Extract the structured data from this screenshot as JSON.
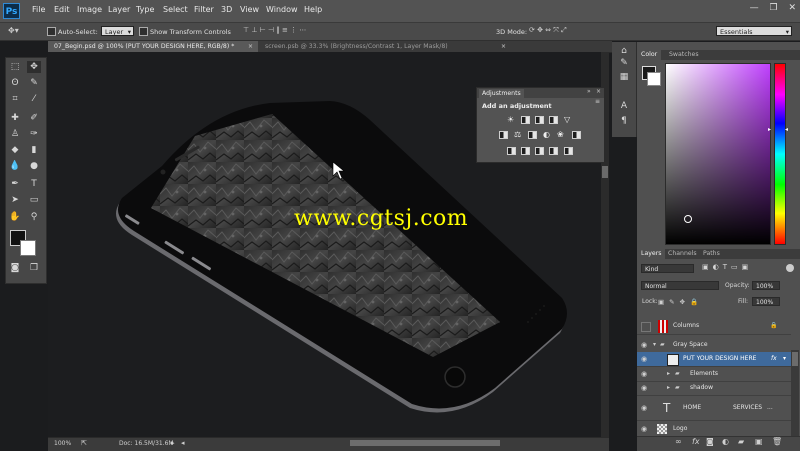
{
  "app": {
    "logo": "Ps"
  },
  "menu": [
    "File",
    "Edit",
    "Image",
    "Layer",
    "Type",
    "Select",
    "Filter",
    "3D",
    "View",
    "Window",
    "Help"
  ],
  "window_controls": [
    "—",
    "❐",
    "✕"
  ],
  "options_bar": {
    "auto_select_label": "Auto-Select:",
    "auto_select_value": "Layer",
    "show_transform_label": "Show Transform Controls",
    "mode_3d_label": "3D Mode:",
    "workspace_value": "Essentials"
  },
  "tabs": [
    {
      "label": "07_Begin.psd @ 100% (PUT YOUR DESIGN HERE, RGB/8) *",
      "close": "×"
    },
    {
      "label": "screen.psb @ 33.3% (Brightness/Contrast 1, Layer Mask/8)",
      "close": "×"
    }
  ],
  "watermark": "www.cgtsj.com",
  "status": {
    "zoom": "100%",
    "doc": "Doc: 16.5M/31.6M"
  },
  "adjustments": {
    "tab": "Adjustments",
    "subtitle": "Add an adjustment"
  },
  "color_panel": {
    "tabs": [
      "Color",
      "Swatches"
    ]
  },
  "layers_panel": {
    "tabs": [
      "Layers",
      "Channels",
      "Paths"
    ],
    "filter_value": "Kind",
    "blend_mode": "Normal",
    "opacity_label": "Opacity:",
    "opacity_value": "100%",
    "lock_label": "Lock:",
    "fill_label": "Fill:",
    "fill_value": "100%",
    "layers": [
      {
        "name": "Columns",
        "type": "layer",
        "visible": false
      },
      {
        "name": "Gray Space",
        "type": "group",
        "visible": true
      },
      {
        "name": "PUT YOUR DESIGN HERE",
        "type": "smart",
        "visible": true,
        "selected": true,
        "fx": "fx"
      },
      {
        "name": "Elements",
        "type": "group",
        "visible": true
      },
      {
        "name": "shadow",
        "type": "group",
        "visible": true
      },
      {
        "name": "HOME",
        "extra": "SERVICES",
        "more": "...",
        "type": "text",
        "visible": true
      },
      {
        "name": "Logo",
        "type": "layer",
        "visible": true
      }
    ]
  },
  "colors": {
    "accent": "#3f6a9c",
    "chrome": "#535353",
    "watermark": "#ffff00"
  }
}
